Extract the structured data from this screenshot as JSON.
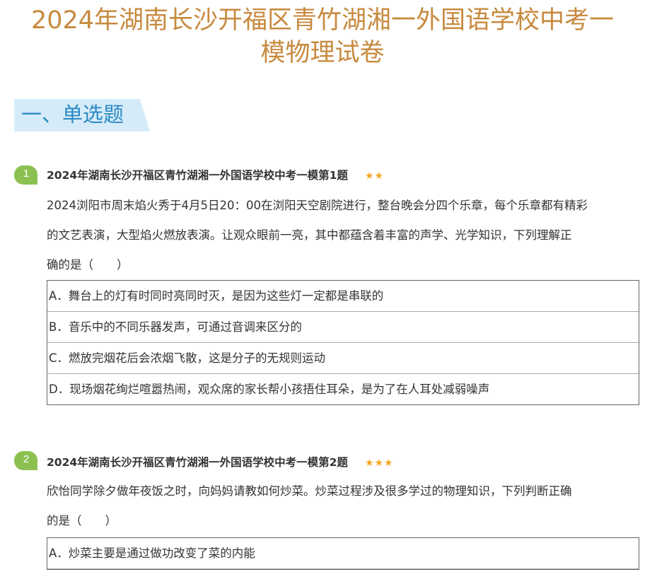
{
  "page": {
    "title_line1": "2024年湖南长沙开福区青竹湖湘一外国语学校中考一",
    "title_line2": "模物理试卷"
  },
  "section": {
    "label": "一、单选题"
  },
  "questions": [
    {
      "number": "1",
      "heading": "2024年湖南长沙开福区青竹湖湘一外国语学校中考一模第1题",
      "stars": "★★",
      "stem_lines": [
        "2024浏阳市周末焰火秀于4月5日20：00在浏阳天空剧院进行，整台晚会分四个乐章，每个乐章都有精彩",
        "的文艺表演，大型焰火燃放表演。让观众眼前一亮，其中都蕴含着丰富的声学、光学知识，下列理解正",
        "确的是（　　）"
      ],
      "options": [
        "A．舞台上的灯有时同时亮同时灭，是因为这些灯一定都是串联的",
        "B．音乐中的不同乐器发声，可通过音调来区分的",
        "C．燃放完烟花后会浓烟飞散，这是分子的无规则运动",
        "D．现场烟花绚烂喧嚣热闹，观众席的家长帮小孩捂住耳朵，是为了在人耳处减弱噪声"
      ]
    },
    {
      "number": "2",
      "heading": "2024年湖南长沙开福区青竹湖湘一外国语学校中考一模第2题",
      "stars": "★★★",
      "stem_lines": [
        "欣怡同学除夕做年夜饭之时，向妈妈请教如何炒菜。炒菜过程涉及很多学过的物理知识，下列判断正确",
        "的是（　　）"
      ],
      "options": [
        "A．炒菜主要是通过做功改变了菜的内能"
      ]
    }
  ],
  "colors": {
    "title": "#c78a3f",
    "section_text": "#2a8ac5",
    "section_bg": "#d6ebf9",
    "badge": "#8cc152",
    "stars": "#f5a623"
  }
}
